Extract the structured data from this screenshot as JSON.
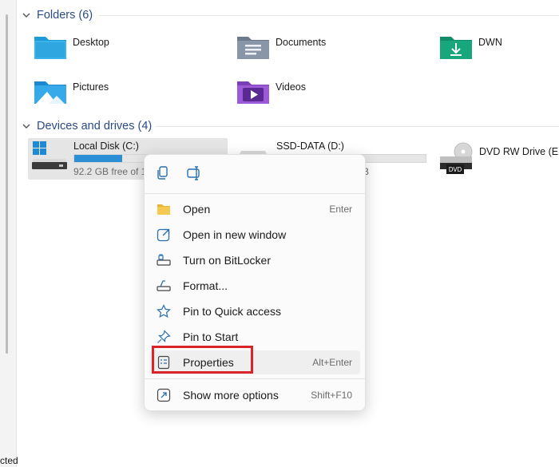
{
  "status": {
    "text": "cted"
  },
  "folders": {
    "header": "Folders (6)",
    "items": [
      {
        "label": "Desktop",
        "icon": "desktop-folder-icon"
      },
      {
        "label": "Documents",
        "icon": "documents-folder-icon"
      },
      {
        "label": "DWN",
        "icon": "downloads-folder-icon"
      },
      {
        "label": "Pictures",
        "icon": "pictures-folder-icon"
      },
      {
        "label": "Videos",
        "icon": "videos-folder-icon"
      }
    ]
  },
  "drives": {
    "header": "Devices and drives (4)",
    "items": [
      {
        "label": "Local Disk (C:)",
        "free_text": "92.2 GB free of 1",
        "used_fraction": 0.32,
        "icon": "windows-drive-icon"
      },
      {
        "label": "SSD-DATA (D:)",
        "free_text": "B",
        "used_fraction": 0.0,
        "icon": "drive-icon"
      },
      {
        "label": "DVD RW Drive (E:)",
        "badge": "DVD",
        "icon": "dvd-drive-icon"
      }
    ]
  },
  "context_menu": {
    "top_actions": [
      {
        "name": "copy-icon"
      },
      {
        "name": "rename-icon"
      }
    ],
    "items": [
      {
        "label": "Open",
        "shortcut": "Enter",
        "icon": "folder-open-icon"
      },
      {
        "label": "Open in new window",
        "shortcut": "",
        "icon": "new-window-icon"
      },
      {
        "label": "Turn on BitLocker",
        "shortcut": "",
        "icon": "bitlocker-icon"
      },
      {
        "label": "Format...",
        "shortcut": "",
        "icon": "format-icon"
      },
      {
        "label": "Pin to Quick access",
        "shortcut": "",
        "icon": "star-icon"
      },
      {
        "label": "Pin to Start",
        "shortcut": "",
        "icon": "pin-icon"
      },
      {
        "label": "Properties",
        "shortcut": "Alt+Enter",
        "icon": "properties-icon"
      },
      {
        "label": "Show more options",
        "shortcut": "Shift+F10",
        "icon": "more-options-icon"
      }
    ]
  },
  "colors": {
    "accent": "#2b8fd6",
    "highlight": "#d9252a",
    "section_title": "#2b4a8a"
  }
}
